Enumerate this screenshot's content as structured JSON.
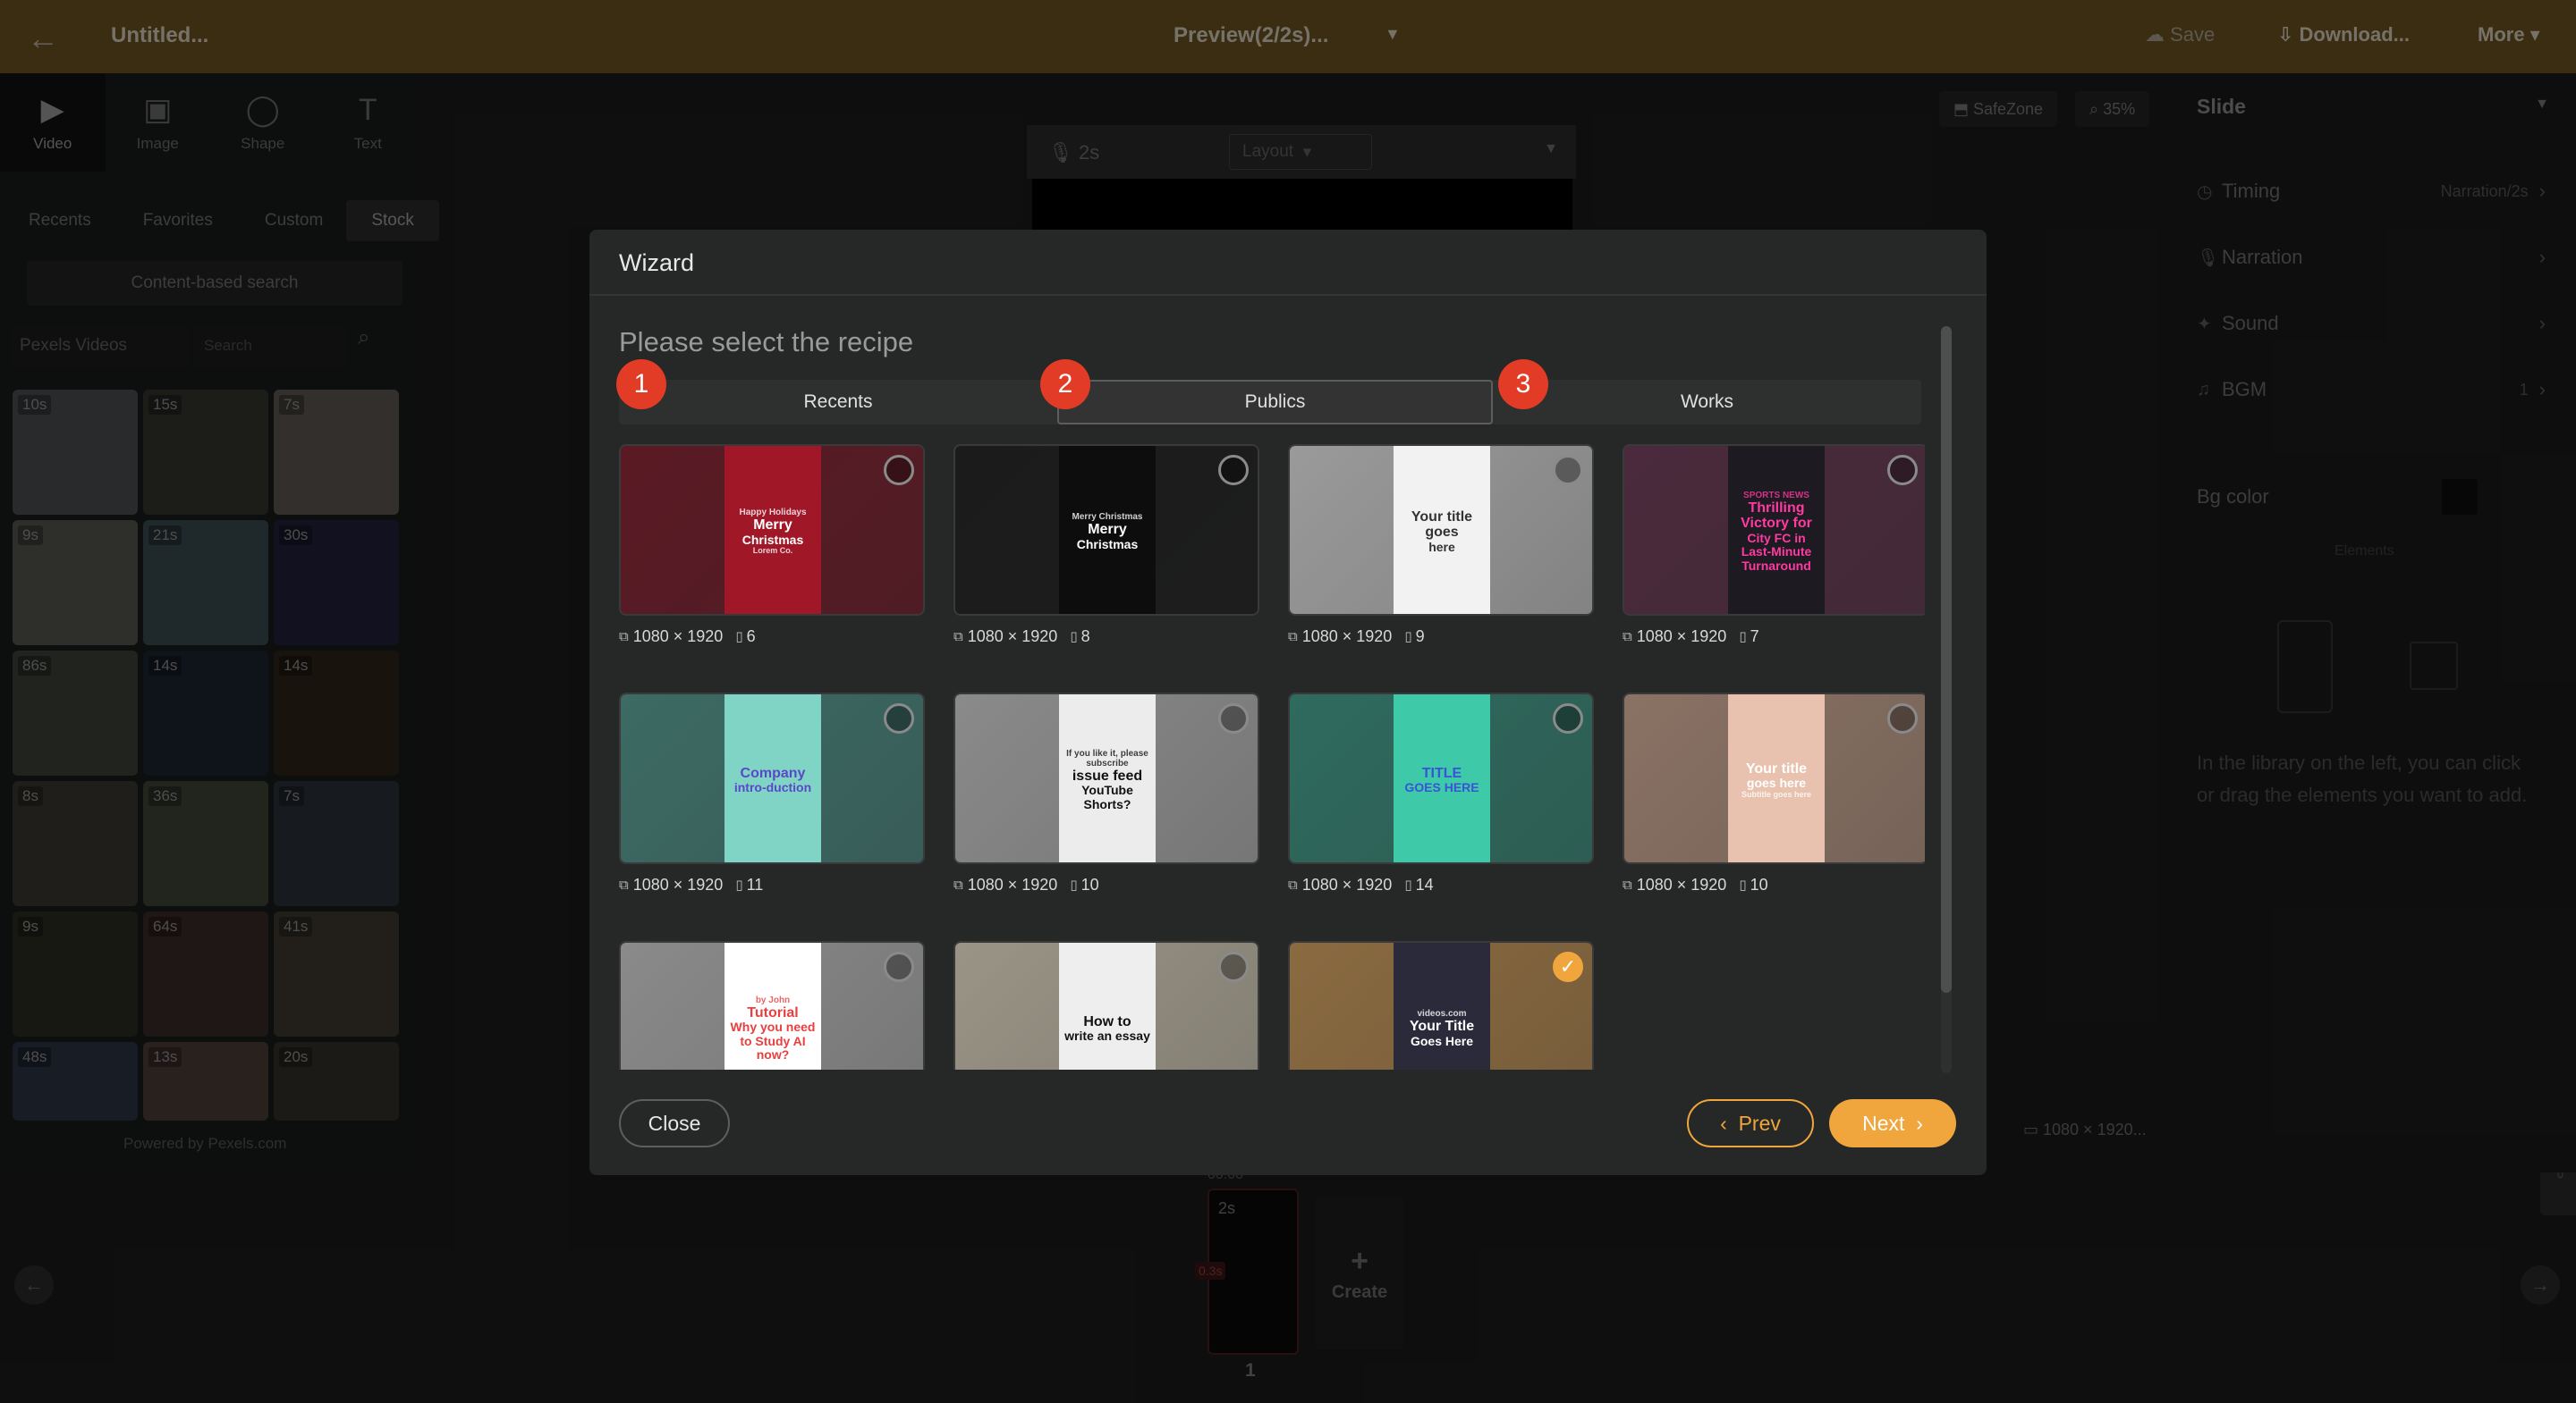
{
  "topbar": {
    "title": "Untitled...",
    "preview": "Preview(2/2s)...",
    "save": "Save",
    "download": "Download...",
    "more": "More"
  },
  "left_panel": {
    "tabs": [
      {
        "label": "Video",
        "icon": "video-icon"
      },
      {
        "label": "Image",
        "icon": "image-icon"
      },
      {
        "label": "Shape",
        "icon": "shape-icon"
      },
      {
        "label": "Text",
        "icon": "text-icon"
      }
    ],
    "subtabs": [
      "Recents",
      "Favorites",
      "Custom",
      "Stock"
    ],
    "search_mode": "Content-based search",
    "source": "Pexels Videos",
    "search_placeholder": "Search",
    "thumbs": [
      "10s",
      "15s",
      "7s",
      "9s",
      "21s",
      "30s",
      "86s",
      "14s",
      "14s",
      "8s",
      "36s",
      "7s",
      "9s",
      "64s",
      "41s",
      "48s",
      "13s",
      "20s"
    ],
    "powered": "Powered by Pexels.com"
  },
  "canvas": {
    "safezone": "SafeZone",
    "zoom": "35%",
    "duration": "2s",
    "layout": "Layout",
    "time": "00:00",
    "slide_duration": "2s",
    "transition": "0.3s",
    "slide_number": "1",
    "create": "Create",
    "dims": "1080 × 1920..."
  },
  "right_panel": {
    "header": "Slide",
    "rows": [
      {
        "label": "Timing",
        "value": "Narration/2s"
      },
      {
        "label": "Narration",
        "value": ""
      },
      {
        "label": "Sound",
        "value": ""
      },
      {
        "label": "BGM",
        "value": "1"
      }
    ],
    "bg_color_label": "Bg color",
    "elements_label": "Elements",
    "hint": "In the library on the left, you can click or drag the elements you want to add.",
    "help": "HELP"
  },
  "wizard": {
    "title": "Wizard",
    "heading": "Please select the recipe",
    "tabs": [
      {
        "label": "Recents",
        "badge": "1"
      },
      {
        "label": "Publics",
        "badge": "2"
      },
      {
        "label": "Works",
        "badge": "3"
      }
    ],
    "active_tab": 1,
    "close": "Close",
    "prev": "Prev",
    "next": "Next",
    "templates": [
      {
        "res": "1080 × 1920",
        "pages": "6",
        "line1": "Merry",
        "line2": "Christmas",
        "top": "Happy Holidays",
        "bottom": "Lorem Co.",
        "bg": "#5a1a24",
        "fg": "#a01828",
        "color": "#ffffff",
        "checked": false
      },
      {
        "res": "1080 × 1920",
        "pages": "8",
        "line1": "Merry",
        "line2": "Christmas",
        "top": "Merry Christmas",
        "bottom": "",
        "bg": "#1b1b1b",
        "fg": "#0d0d0d",
        "color": "#ffffff",
        "checked": false
      },
      {
        "res": "1080 × 1920",
        "pages": "9",
        "line1": "Your title goes",
        "line2": "here",
        "top": "",
        "bottom": "",
        "bg": "#9a9a9a",
        "fg": "#f2f2f2",
        "color": "#333333",
        "checked": false
      },
      {
        "res": "1080 × 1920",
        "pages": "7",
        "line1": "Thrilling Victory for",
        "line2": "City FC in Last-Minute Turnaround",
        "top": "SPORTS NEWS",
        "bottom": "",
        "bg": "#4a2a3c",
        "fg": "#1e1a22",
        "color": "#ff3aa0",
        "checked": false
      },
      {
        "res": "1080 × 1920",
        "pages": "11",
        "line1": "Company",
        "line2": "intro-duction",
        "top": "",
        "bottom": "",
        "bg": "#3d6a64",
        "fg": "#7fd4c6",
        "color": "#5a48c8",
        "checked": false
      },
      {
        "res": "1080 × 1920",
        "pages": "10",
        "line1": "issue feed",
        "line2": "YouTube Shorts?",
        "top": "If you like it, please subscribe",
        "bottom": "",
        "bg": "#8a8a8a",
        "fg": "#ececec",
        "color": "#111111",
        "checked": false
      },
      {
        "res": "1080 × 1920",
        "pages": "14",
        "line1": "TITLE",
        "line2": "GOES HERE",
        "top": "",
        "bottom": "",
        "bg": "#2f6a5e",
        "fg": "#3ec9a8",
        "color": "#3a54d8",
        "checked": false
      },
      {
        "res": "1080 × 1920",
        "pages": "10",
        "line1": "Your title",
        "line2": "goes here",
        "top": "",
        "bottom": "Subtitle goes here",
        "bg": "#8a7264",
        "fg": "#e8c2ae",
        "color": "#ffffff",
        "checked": false
      },
      {
        "res": "",
        "pages": "",
        "line1": "Tutorial",
        "line2": "Why you need to Study AI now?",
        "top": "by John",
        "bottom": "",
        "bg": "#8a8a8a",
        "fg": "#ffffff",
        "color": "#e84040",
        "checked": false
      },
      {
        "res": "",
        "pages": "",
        "line1": "How to",
        "line2": "write an essay",
        "top": "",
        "bottom": "",
        "bg": "#9a9486",
        "fg": "#eeeeee",
        "color": "#111111",
        "checked": false
      },
      {
        "res": "",
        "pages": "",
        "line1": "Your Title",
        "line2": "Goes Here",
        "top": "videos.com",
        "bottom": "",
        "bg": "#8a6a40",
        "fg": "#2a2a3a",
        "color": "#ffffff",
        "checked": true
      }
    ]
  }
}
